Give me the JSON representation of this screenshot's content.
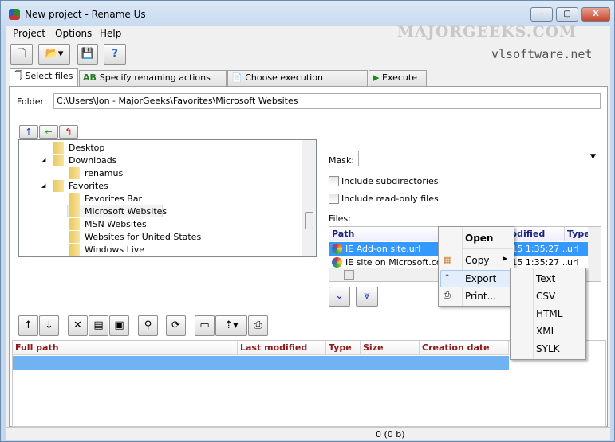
{
  "window": {
    "title": "New project - Rename Us",
    "watermark": "MAJORGEEKS.COM",
    "brand": "vlsoftware.net"
  },
  "menu": [
    "Project",
    "Options",
    "Help"
  ],
  "tabs": [
    "Select files",
    "Specify renaming actions (rules)",
    "Choose execution parameters",
    "Execute"
  ],
  "folder": {
    "label": "Folder:",
    "value": "C:\\Users\\Jon - MajorGeeks\\Favorites\\Microsoft Websites"
  },
  "tree": [
    {
      "label": "Desktop",
      "level": 1,
      "expanded": null
    },
    {
      "label": "Downloads",
      "level": 1,
      "expanded": true
    },
    {
      "label": "renamus",
      "level": 2,
      "expanded": null
    },
    {
      "label": "Favorites",
      "level": 1,
      "expanded": true
    },
    {
      "label": "Favorites Bar",
      "level": 2
    },
    {
      "label": "Microsoft Websites",
      "level": 2,
      "selected": true
    },
    {
      "label": "MSN Websites",
      "level": 2
    },
    {
      "label": "Websites for United States",
      "level": 2
    },
    {
      "label": "Windows Live",
      "level": 2
    }
  ],
  "mask": {
    "label": "Mask:",
    "value": ""
  },
  "options": {
    "subdirs": "Include subdirectories",
    "readonly": "Include read-only files"
  },
  "files": {
    "label": "Files:",
    "columns": [
      "Path",
      "Last modified date",
      "Type"
    ],
    "rows": [
      {
        "path": "IE Add-on site.url",
        "date": "1/13/2015 1:35:27 ...",
        "type": "url",
        "selected": true
      },
      {
        "path": "IE site on Microsoft.com",
        "date": "1/13/2015 1:35:27 ...",
        "type": "url"
      }
    ]
  },
  "context_menu": {
    "items": [
      "Open",
      "Copy",
      "Export",
      "Print..."
    ],
    "submenu": [
      "Text",
      "CSV",
      "HTML",
      "XML",
      "SYLK"
    ]
  },
  "selected": {
    "columns": [
      "Full path",
      "Last modified date",
      "Type",
      "Size",
      "Creation date"
    ]
  },
  "status": {
    "count": "0  (0 b)"
  }
}
